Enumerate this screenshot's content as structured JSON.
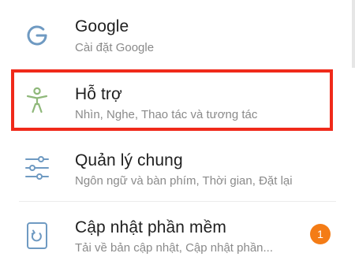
{
  "settings": {
    "items": [
      {
        "title": "Google",
        "subtitle": "Cài đặt Google",
        "icon": "google-g-icon"
      },
      {
        "title": "Hỗ trợ",
        "subtitle": "Nhìn, Nghe, Thao tác và tương tác",
        "icon": "accessibility-person-icon",
        "highlighted": true
      },
      {
        "title": "Quản lý chung",
        "subtitle": "Ngôn ngữ và bàn phím, Thời gian, Đặt lại",
        "icon": "sliders-icon"
      },
      {
        "title": "Cập nhật phần mềm",
        "subtitle": "Tải về bản cập nhật, Cập nhật phần...",
        "icon": "software-update-icon",
        "badge": "1"
      }
    ]
  },
  "colors": {
    "icon": "#6f9ac2",
    "accessibility_icon": "#8fb87a",
    "highlight_border": "#f02a1a",
    "badge": "#f47c16"
  }
}
